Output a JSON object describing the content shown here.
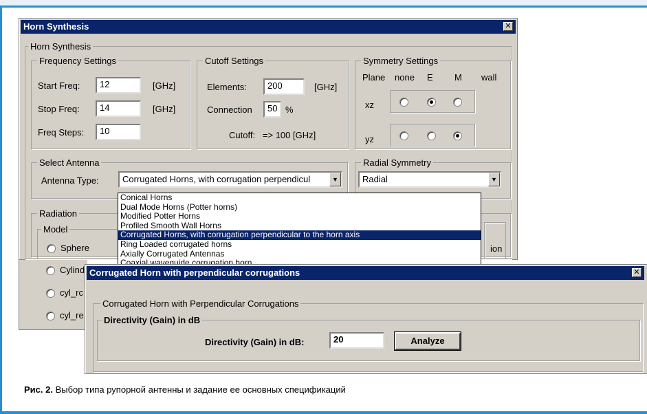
{
  "main_window": {
    "title": "Horn Synthesis",
    "outer_group": "Horn Synthesis",
    "frequency": {
      "legend": "Frequency Settings",
      "start_label": "Start Freq:",
      "start_value": "12",
      "start_unit": "[GHz]",
      "stop_label": "Stop Freq:",
      "stop_value": "14",
      "stop_unit": "[GHz]",
      "steps_label": "Freq Steps:",
      "steps_value": "10"
    },
    "cutoff": {
      "legend": "Cutoff Settings",
      "elements_label": "Elements:",
      "elements_value": "200",
      "elements_unit": "[GHz]",
      "connection_label": "Connection",
      "connection_value": "50",
      "connection_unit": "%",
      "cutoff_text": "Cutoff:   => 100 [GHz]"
    },
    "symmetry": {
      "legend": "Symmetry Settings",
      "headers": [
        "Plane",
        "none",
        "E",
        "M",
        "wall"
      ],
      "rows": [
        {
          "label": "xz",
          "selected": "E"
        },
        {
          "label": "yz",
          "selected": "M"
        }
      ]
    },
    "antenna": {
      "legend": "Select Antenna",
      "type_label": "Antenna Type:",
      "selected": "Corrugated Horns, with corrugation perpendicul",
      "options": [
        "Conical Horns",
        "Dual Mode Horns (Potter horns)",
        "Modified Potter Horns",
        "Profiled Smooth Wall Horns",
        "Corrugated Horns, with corrugation perpendicular to the horn axis",
        "Ring Loaded corrugated horns",
        "Axially Corrugated Antennas",
        "Coaxial waveguide corrugation horn"
      ],
      "selected_index": 4
    },
    "radial": {
      "legend": "Radial Symmetry",
      "selected": "Radial"
    },
    "radiation": {
      "legend": "Radiation",
      "model_legend": "Model",
      "models": [
        "Sphere",
        "Cylinder",
        "cyl_rc",
        "cyl_re"
      ],
      "right_fragment_1": "ion"
    }
  },
  "sub_window": {
    "title": "Corrugated Horn with perpendicular corrugations",
    "group": "Corrugated Horn with Perpendicular Corrugations",
    "inner_legend": "Directivity (Gain) in dB",
    "directivity_label": "Directivity (Gain) in dB:",
    "directivity_value": "20",
    "analyze_label": "Analyze"
  },
  "caption": {
    "prefix": "Рис. 2.",
    "text": "Выбор типа рупорной антенны и задание ее основных спецификаций"
  },
  "colors": {
    "titlebar": "#0a246a",
    "frame": "#2a8fcf",
    "window_bg": "#d4d0c8"
  }
}
